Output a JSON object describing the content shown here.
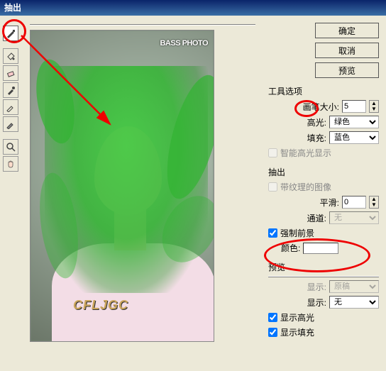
{
  "title": "抽出",
  "tools": {
    "highlighter": "edge-highlighter-tool",
    "fill": "fill-tool",
    "eraser": "eraser-tool",
    "eyedropper": "eyedropper-tool",
    "cleanup": "cleanup-tool",
    "edge": "edge-touchup-tool",
    "zoom": "zoom-tool",
    "hand": "hand-tool"
  },
  "watermark_top": "BASS  PHOTO",
  "watermark_bottom": "CFLJGC",
  "buttons": {
    "ok": "确定",
    "cancel": "取消",
    "preview": "预览"
  },
  "toolOptions": {
    "section": "工具选项",
    "brushSizeLabel": "画笔大小:",
    "brushSizeValue": "5",
    "highlightLabel": "高光:",
    "highlightValue": "绿色",
    "fillLabel": "填充:",
    "fillValue": "蓝色",
    "smartHighlight": "智能高光显示"
  },
  "extraction": {
    "section": "抽出",
    "texturedImage": "带纹理的图像",
    "smoothLabel": "平滑:",
    "smoothValue": "0",
    "channelLabel": "通道:",
    "channelValue": "无",
    "forceForeground": "强制前景",
    "colorLabel": "颜色:"
  },
  "previewSection": {
    "section": "预览",
    "showLabel1": "显示:",
    "showValue1": "原稿",
    "showLabel2": "显示:",
    "showValue2": "无",
    "showHighlight": "显示高光",
    "showFill": "显示填充"
  }
}
